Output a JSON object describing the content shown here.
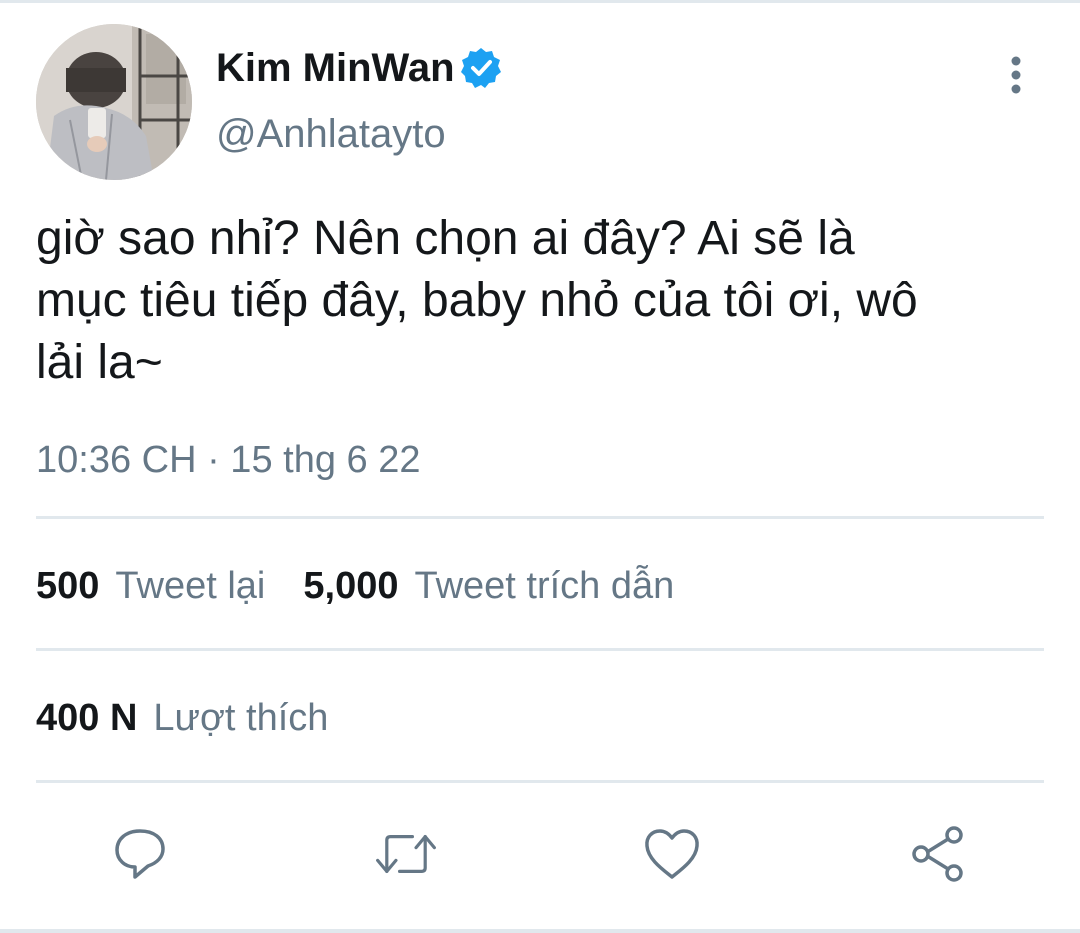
{
  "user": {
    "display_name": "Kim MinWan",
    "handle": "@Anhlatayto",
    "avatar": "profile-photo",
    "verified_icon": "verified-badge-icon"
  },
  "menu": {
    "icon": "more-vertical-icon"
  },
  "tweet": {
    "text": "giờ sao nhỉ? Nên chọn ai đây? Ai sẽ là\nmục tiêu tiếp đây, baby nhỏ của tôi ơi, wô\nlải la~",
    "timestamp": "10:36 CH · 15 thg 6 22"
  },
  "stats": {
    "retweets": {
      "count": "500",
      "label": "Tweet lại"
    },
    "quote_tweets": {
      "count": "5,000",
      "label": "Tweet trích dẫn"
    },
    "likes": {
      "count": "400 N",
      "label": "Lượt thích"
    }
  },
  "actions": [
    {
      "icon": "reply-icon"
    },
    {
      "icon": "retweet-icon"
    },
    {
      "icon": "like-icon"
    },
    {
      "icon": "share-icon"
    }
  ],
  "colors": {
    "verified_blue": "#1da1f2",
    "secondary_text": "#657786",
    "primary_text": "#14171a",
    "divider": "#e1e8ed"
  }
}
